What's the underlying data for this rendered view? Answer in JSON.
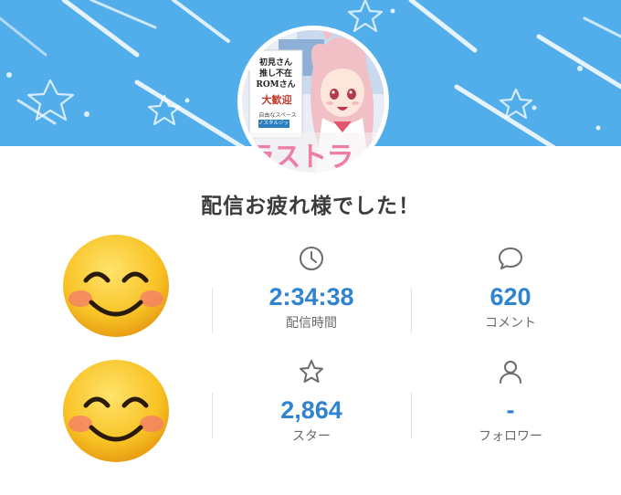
{
  "colors": {
    "banner": "#52aeea",
    "accent_value": "#2f83cf",
    "label": "#6b6b6b",
    "headline": "#3b3b3b"
  },
  "avatar": {
    "poster_lines": [
      "初見さん",
      "推し不在",
      "ROMさん"
    ],
    "poster_welcome": "大歓迎",
    "poster_small": "自由なスペース作業",
    "poster_box": "ノスタルジック",
    "title_fragment": "ラストラ"
  },
  "headline": "配信お疲れ様でした！",
  "stats": [
    {
      "icon": "clock-icon",
      "value": "2:34:38",
      "label": "配信時間"
    },
    {
      "icon": "comment-icon",
      "value": "620",
      "label": "コメント"
    },
    {
      "icon": "star-icon",
      "value": "2,864",
      "label": "スター"
    },
    {
      "icon": "person-icon",
      "value": "-",
      "label": "フォロワー"
    }
  ]
}
